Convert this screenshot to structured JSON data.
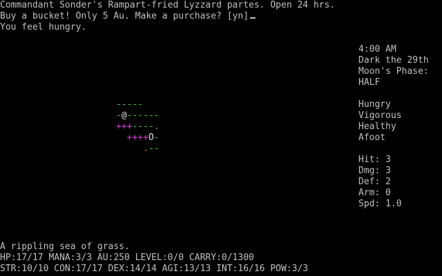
{
  "messages": {
    "line1": "Commandant Sonder's Rampart-fried Lyzzard partes. Open 24 hrs.",
    "line2": "Buy a bucket! Only 5 Au. Make a purchase? [yn]",
    "line3": "You feel hungry."
  },
  "sidebar": {
    "time": "4:00 AM",
    "date": "Dark the 29th",
    "moon_label": "Moon's Phase:",
    "moon_phase": "HALF",
    "status": [
      "Hungry",
      "Vigorous",
      "Healthy",
      "Afoot"
    ],
    "stats": {
      "hit": "Hit: 3",
      "dmg": "Dmg: 3",
      "def": "Def: 2",
      "arm": "Arm: 0",
      "spd": "Spd: 1.0"
    }
  },
  "map": {
    "rows": [
      {
        "pre": "",
        "segs": [
          {
            "t": "-----",
            "c": "g"
          }
        ]
      },
      {
        "pre": "",
        "segs": [
          {
            "t": "-",
            "c": "g"
          },
          {
            "t": "@",
            "c": "w"
          },
          {
            "t": "------",
            "c": "g"
          }
        ]
      },
      {
        "pre": "",
        "segs": [
          {
            "t": "+++",
            "c": "m"
          },
          {
            "t": "----",
            "c": "g"
          },
          {
            "t": ".",
            "c": "o"
          }
        ]
      },
      {
        "pre": "  ",
        "segs": [
          {
            "t": "++++",
            "c": "m"
          },
          {
            "t": "O",
            "c": "w"
          },
          {
            "t": "-",
            "c": "g"
          }
        ]
      },
      {
        "pre": "    ",
        "segs": [
          {
            "t": " .",
            "c": "o"
          },
          {
            "t": "--",
            "c": "g"
          }
        ]
      }
    ]
  },
  "footer": {
    "terrain": "A rippling sea of grass.",
    "vitals": "HP:17/17 MANA:3/3 AU:250 LEVEL:0/0 CARRY:0/1300",
    "attributes": "STR:10/10 CON:17/17 DEX:14/14 AGI:13/13 INT:16/16 POW:3/3"
  },
  "colors": {
    "background": "#000000",
    "text": "#c0c0c0",
    "grass": "#44cc44",
    "magic": "#e040e0",
    "item": "#e06030"
  }
}
